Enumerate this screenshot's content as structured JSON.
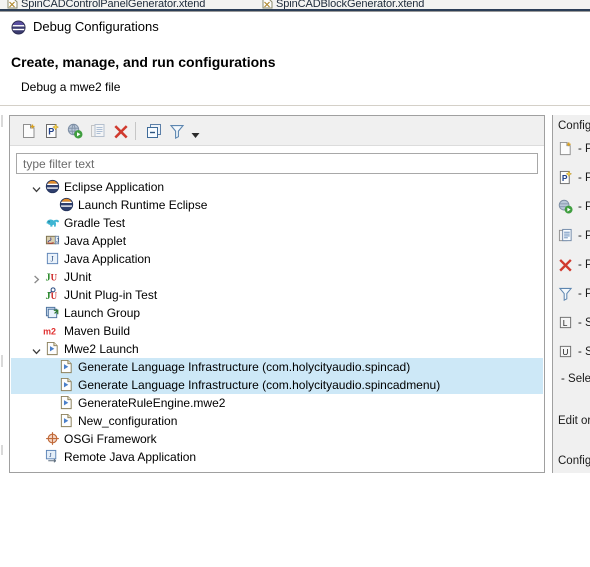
{
  "background_tabs": [
    {
      "label": "SpinCADControlPanelGenerator.xtend",
      "icon": "xtend-file-icon"
    },
    {
      "label": "SpinCADBlockGenerator.xtend",
      "icon": "xtend-file-icon"
    }
  ],
  "dialog": {
    "title": "Debug Configurations",
    "title_icon": "eclipse-debug-icon",
    "heading": "Create, manage, and run configurations",
    "subheading": "Debug a mwe2 file"
  },
  "toolbar": {
    "buttons": [
      {
        "name": "new-launch-configuration-button",
        "icon": "new-config-icon",
        "tooltip": "New launch configuration",
        "enabled": true
      },
      {
        "name": "new-prototype-button",
        "icon": "new-prototype-icon",
        "tooltip": "New prototype",
        "enabled": true
      },
      {
        "name": "export-button",
        "icon": "export-icon",
        "tooltip": "Export",
        "enabled": true
      },
      {
        "name": "duplicate-button",
        "icon": "duplicate-icon",
        "tooltip": "Duplicate",
        "enabled": false
      },
      {
        "name": "delete-button",
        "icon": "delete-red-x-icon",
        "tooltip": "Delete",
        "enabled": true
      },
      {
        "name": "collapse-all-button",
        "icon": "collapse-all-icon",
        "tooltip": "Collapse All",
        "enabled": true
      },
      {
        "name": "filter-button",
        "icon": "filter-funnel-icon",
        "tooltip": "Filter launch configurations",
        "enabled": true
      },
      {
        "name": "view-menu-button",
        "icon": "chevron-down-icon",
        "tooltip": "View Menu",
        "enabled": true
      }
    ]
  },
  "filter": {
    "placeholder": "type filter text",
    "value": ""
  },
  "tree": {
    "items": [
      {
        "label": "Eclipse Application",
        "icon": "eclipse-app-icon",
        "indent": 0,
        "twisty": "expanded",
        "selected": false
      },
      {
        "label": "Launch Runtime Eclipse",
        "icon": "eclipse-app-icon",
        "indent": 1,
        "twisty": "none",
        "selected": false
      },
      {
        "label": "Gradle Test",
        "icon": "gradle-elephant-icon",
        "indent": 0,
        "twisty": "none",
        "selected": false
      },
      {
        "label": "Java Applet",
        "icon": "java-applet-icon",
        "indent": 0,
        "twisty": "none",
        "selected": false
      },
      {
        "label": "Java Application",
        "icon": "java-application-icon",
        "indent": 0,
        "twisty": "none",
        "selected": false
      },
      {
        "label": "JUnit",
        "icon": "junit-icon",
        "indent": 0,
        "twisty": "collapsed",
        "selected": false
      },
      {
        "label": "JUnit Plug-in Test",
        "icon": "junit-plugin-icon",
        "indent": 0,
        "twisty": "none",
        "selected": false
      },
      {
        "label": "Launch Group",
        "icon": "launch-group-icon",
        "indent": 0,
        "twisty": "none",
        "selected": false
      },
      {
        "label": "Maven Build",
        "icon": "maven-m2-icon",
        "indent": 0,
        "twisty": "none",
        "selected": false
      },
      {
        "label": "Mwe2 Launch",
        "icon": "mwe2-launch-icon",
        "indent": 0,
        "twisty": "expanded",
        "selected": false
      },
      {
        "label": "Generate Language Infrastructure (com.holycityaudio.spincad)",
        "icon": "mwe2-config-icon",
        "indent": 1,
        "twisty": "none",
        "selected": true
      },
      {
        "label": "Generate Language Infrastructure (com.holycityaudio.spincadmenu)",
        "icon": "mwe2-config-icon",
        "indent": 1,
        "twisty": "none",
        "selected": true
      },
      {
        "label": "GenerateRuleEngine.mwe2",
        "icon": "mwe2-config-icon",
        "indent": 1,
        "twisty": "none",
        "selected": false
      },
      {
        "label": "New_configuration",
        "icon": "mwe2-config-icon",
        "indent": 1,
        "twisty": "none",
        "selected": false
      },
      {
        "label": "OSGi Framework",
        "icon": "osgi-icon",
        "indent": 0,
        "twisty": "none",
        "selected": false
      },
      {
        "label": "Remote Java Application",
        "icon": "remote-java-icon",
        "indent": 0,
        "twisty": "none",
        "selected": false
      }
    ]
  },
  "help_panel": {
    "clipped": true,
    "title": "Config",
    "entries": [
      {
        "icon": "new-config-icon",
        "text": "- P"
      },
      {
        "icon": "new-prototype-icon",
        "text": "- P"
      },
      {
        "icon": "export-icon",
        "text": "- P"
      },
      {
        "icon": "duplicate-icon",
        "text": "- P"
      },
      {
        "icon": "delete-red-x-icon",
        "text": "- P"
      },
      {
        "icon": "filter-funnel-icon",
        "text": "- P"
      },
      {
        "icon": "link-prototype-icon",
        "text": "- S"
      },
      {
        "icon": "unlink-prototype-icon",
        "text": "- S"
      }
    ],
    "plain_lines": [
      "- Selec",
      "Edit or",
      "Config"
    ]
  },
  "colors": {
    "selection": "#cde8f7",
    "toolbar_bg": "#f0f0f0",
    "panel_bg": "#f0f0f0",
    "border": "#a0a0a0",
    "delete_red": "#d03a2e",
    "maven_red": "#e03030",
    "junit_green": "#2e8b2e",
    "tab_underline": "#2c3e56"
  }
}
